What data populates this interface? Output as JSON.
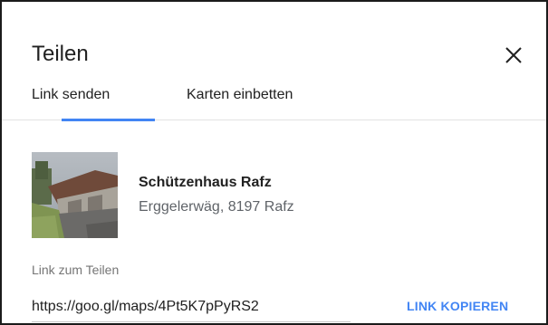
{
  "dialog": {
    "title": "Teilen",
    "close_icon": "close-icon"
  },
  "tabs": [
    {
      "label": "Link senden",
      "active": true
    },
    {
      "label": "Karten einbetten",
      "active": false
    }
  ],
  "place": {
    "name": "Schützenhaus Rafz",
    "address": "Erggelerwäg, 8197 Rafz"
  },
  "share": {
    "label": "Link zum Teilen",
    "url": "https://goo.gl/maps/4Pt5K7pPyRS2",
    "copy_label": "LINK KOPIEREN"
  },
  "colors": {
    "accent": "#4285f4",
    "text": "#212121",
    "secondary_text": "#5f6368"
  }
}
